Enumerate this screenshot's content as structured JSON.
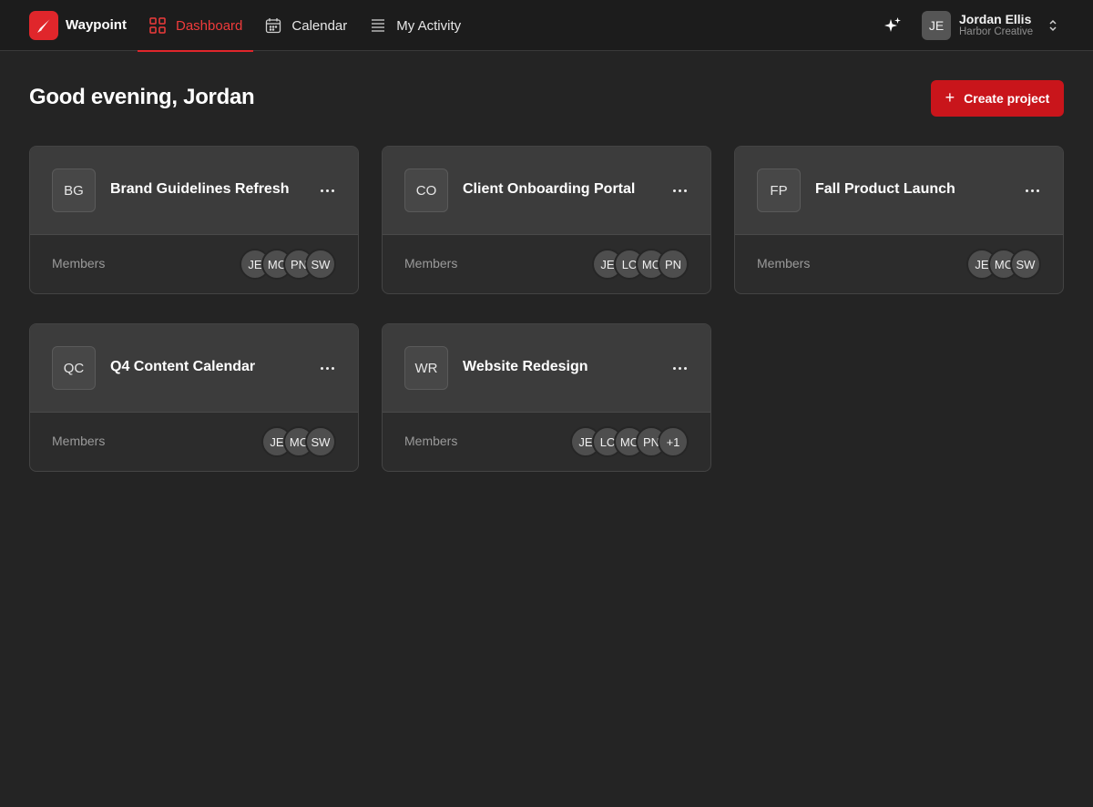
{
  "app": {
    "name": "Waypoint",
    "accent": "#e0262b"
  },
  "nav": {
    "items": [
      {
        "label": "Dashboard",
        "icon": "grid-icon",
        "active": true
      },
      {
        "label": "Calendar",
        "icon": "calendar-icon",
        "active": false
      },
      {
        "label": "My Activity",
        "icon": "list-icon",
        "active": false
      }
    ]
  },
  "account": {
    "initials": "JE",
    "name": "Jordan Ellis",
    "org": "Harbor Creative"
  },
  "header": {
    "greeting": "Good evening, Jordan",
    "create_label": "Create project"
  },
  "projects": [
    {
      "initials": "BG",
      "title": "Brand Guidelines Refresh",
      "members_label": "Members",
      "members": [
        "JE",
        "MC",
        "PN",
        "SW"
      ]
    },
    {
      "initials": "CO",
      "title": "Client Onboarding Portal",
      "members_label": "Members",
      "members": [
        "JE",
        "LC",
        "MC",
        "PN"
      ]
    },
    {
      "initials": "FP",
      "title": "Fall Product Launch",
      "members_label": "Members",
      "members": [
        "JE",
        "MC",
        "SW"
      ]
    },
    {
      "initials": "QC",
      "title": "Q4 Content Calendar",
      "members_label": "Members",
      "members": [
        "JE",
        "MC",
        "SW"
      ]
    },
    {
      "initials": "WR",
      "title": "Website Redesign",
      "members_label": "Members",
      "members": [
        "JE",
        "LC",
        "MC",
        "PN",
        "+1"
      ]
    }
  ]
}
